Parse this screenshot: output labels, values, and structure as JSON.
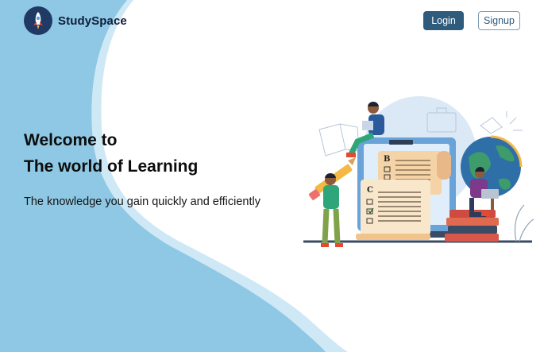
{
  "brand": {
    "name": "StudySpace",
    "logo_icon": "rocket-icon"
  },
  "nav": {
    "login_label": "Login",
    "signup_label": "Signup"
  },
  "hero": {
    "title_line1": "Welcome to",
    "title_line2": "The world of Learning",
    "subtitle": "The knowledge you gain quickly and efficiently"
  },
  "illustration": {
    "icons": [
      "checklist-icon",
      "globe-icon",
      "books-icon",
      "laptop-icon",
      "pencil-icon"
    ],
    "checklist_letters": [
      "B",
      "C"
    ]
  },
  "colors": {
    "wave_blue": "#8ec8e4",
    "wave_light": "#cfe8f5",
    "login_bg": "#2f5b7d",
    "signup_border": "#7d9cb5",
    "logo_bg": "#203a66"
  }
}
